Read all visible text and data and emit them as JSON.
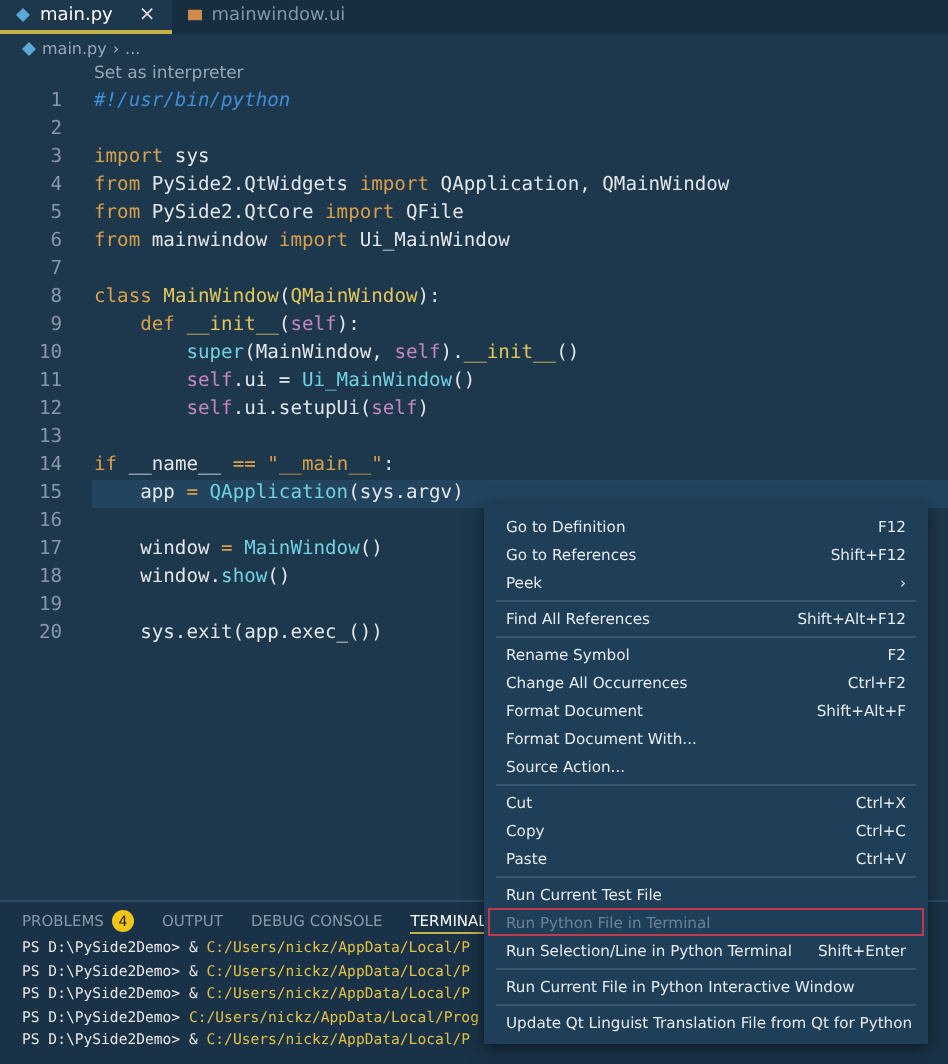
{
  "tabs": [
    {
      "label": "main.py",
      "selected": true,
      "close": "×",
      "kind": "python"
    },
    {
      "label": "mainwindow.ui",
      "selected": false,
      "kind": "ui"
    }
  ],
  "breadcrumb": {
    "file": "main.py",
    "separator": "›",
    "more": "..."
  },
  "codelens": "Set as interpreter",
  "editor": {
    "lines": [
      {
        "number": "1",
        "current": false,
        "tokens": [
          {
            "text": "#!/usr/bin/python",
            "kind": "comment"
          }
        ]
      },
      {
        "number": "2",
        "current": false
      },
      {
        "number": "3",
        "current": false,
        "tokens": [
          {
            "text": "import",
            "kind": "keyword"
          },
          {
            "text": " sys",
            "kind": "plain"
          }
        ]
      },
      {
        "number": "4",
        "current": false,
        "tokens": [
          {
            "text": "from",
            "kind": "keyword"
          },
          {
            "text": " PySide2.QtWidgets ",
            "kind": "plain"
          },
          {
            "text": "import",
            "kind": "keyword"
          },
          {
            "text": " QApplication, QMainWindow",
            "kind": "plain"
          }
        ]
      },
      {
        "number": "5",
        "current": false,
        "tokens": [
          {
            "text": "from",
            "kind": "keyword"
          },
          {
            "text": " PySide2.QtCore ",
            "kind": "plain"
          },
          {
            "text": "import",
            "kind": "keyword"
          },
          {
            "text": " QFile",
            "kind": "plain"
          }
        ]
      },
      {
        "number": "6",
        "current": false,
        "tokens": [
          {
            "text": "from",
            "kind": "keyword"
          },
          {
            "text": " mainwindow ",
            "kind": "plain"
          },
          {
            "text": "import",
            "kind": "keyword"
          },
          {
            "text": " Ui_MainWindow",
            "kind": "plain"
          }
        ]
      },
      {
        "number": "7",
        "current": false
      },
      {
        "number": "8",
        "current": false,
        "tokens": [
          {
            "text": "class",
            "kind": "keyword"
          },
          {
            "text": " MainWindow",
            "kind": "classname"
          },
          {
            "text": "(",
            "kind": "plain"
          },
          {
            "text": "QMainWindow",
            "kind": "classname"
          },
          {
            "text": "):",
            "kind": "plain"
          }
        ]
      },
      {
        "number": "9",
        "current": false,
        "tokens": [
          {
            "text": "    def",
            "kind": "keyword"
          },
          {
            "text": " __init__",
            "kind": "func"
          },
          {
            "text": "(",
            "kind": "plain"
          },
          {
            "text": "self",
            "kind": "self"
          },
          {
            "text": "):",
            "kind": "plain"
          }
        ]
      },
      {
        "number": "10",
        "current": false,
        "tokens": [
          {
            "text": "        super",
            "kind": "builtin"
          },
          {
            "text": "(MainWindow, ",
            "kind": "plain"
          },
          {
            "text": "self",
            "kind": "self"
          },
          {
            "text": ").",
            "kind": "plain"
          },
          {
            "text": "__init__",
            "kind": "func"
          },
          {
            "text": "()",
            "kind": "plain"
          }
        ]
      },
      {
        "number": "11",
        "current": false,
        "tokens": [
          {
            "text": "        self",
            "kind": "self"
          },
          {
            "text": ".ui = ",
            "kind": "plain"
          },
          {
            "text": "Ui_MainWindow",
            "kind": "builtin"
          },
          {
            "text": "()",
            "kind": "plain"
          }
        ]
      },
      {
        "number": "12",
        "current": false,
        "tokens": [
          {
            "text": "        self",
            "kind": "self"
          },
          {
            "text": ".ui.setupUi(",
            "kind": "plain"
          },
          {
            "text": "self",
            "kind": "self"
          },
          {
            "text": ")",
            "kind": "plain"
          }
        ]
      },
      {
        "number": "13",
        "current": false
      },
      {
        "number": "14",
        "current": false,
        "tokens": [
          {
            "text": "if",
            "kind": "keyword"
          },
          {
            "text": " __name__ ",
            "kind": "plain"
          },
          {
            "text": "==",
            "kind": "keyword"
          },
          {
            "text": " \"__main__\"",
            "kind": "string"
          },
          {
            "text": ":",
            "kind": "plain"
          }
        ]
      },
      {
        "number": "15",
        "current": true,
        "tokens": [
          {
            "text": "    app ",
            "kind": "plain"
          },
          {
            "text": "=",
            "kind": "keyword"
          },
          {
            "text": " QApplication",
            "kind": "builtin"
          },
          {
            "text": "(sys.argv)",
            "kind": "plain"
          }
        ]
      },
      {
        "number": "16",
        "current": false
      },
      {
        "number": "17",
        "current": false,
        "tokens": [
          {
            "text": "    window ",
            "kind": "plain"
          },
          {
            "text": "=",
            "kind": "keyword"
          },
          {
            "text": " MainWindow",
            "kind": "builtin"
          },
          {
            "text": "()",
            "kind": "plain"
          }
        ]
      },
      {
        "number": "18",
        "current": false,
        "tokens": [
          {
            "text": "    window.",
            "kind": "plain"
          },
          {
            "text": "show",
            "kind": "builtin"
          },
          {
            "text": "()",
            "kind": "plain"
          }
        ]
      },
      {
        "number": "19",
        "current": false
      },
      {
        "number": "20",
        "current": false,
        "tokens": [
          {
            "text": "    sys.exit(app.exec_())",
            "kind": "plain"
          }
        ]
      }
    ]
  },
  "panel": {
    "tabs": [
      {
        "label": "PROBLEMS",
        "selected": false,
        "badge": "4"
      },
      {
        "label": "OUTPUT",
        "selected": false
      },
      {
        "label": "DEBUG CONSOLE",
        "selected": false
      },
      {
        "label": "TERMINAL",
        "selected": true
      }
    ],
    "terminal": [
      [
        {
          "text": "PS D:\\PySide2Demo> & ",
          "kind": "prompt"
        },
        {
          "text": "C:/Users/nickz/AppData/Local/P",
          "kind": "path"
        }
      ],
      [
        {
          "text": "PS D:\\PySide2Demo> & ",
          "kind": "prompt"
        },
        {
          "text": "C:/Users/nickz/AppData/Local/P",
          "kind": "path"
        }
      ],
      [
        {
          "text": "PS D:\\PySide2Demo> & ",
          "kind": "prompt"
        },
        {
          "text": "C:/Users/nickz/AppData/Local/P",
          "kind": "path"
        }
      ],
      [
        {
          "text": "PS D:\\PySide2Demo> ",
          "kind": "prompt"
        },
        {
          "text": "C:/Users/nickz/AppData/Local/Prog",
          "kind": "path"
        }
      ],
      [
        {
          "text": "PS D:\\PySide2Demo> & ",
          "kind": "prompt"
        },
        {
          "text": "C:/Users/nickz/AppData/Local/P",
          "kind": "path"
        }
      ]
    ]
  },
  "context_menu": [
    {
      "kind": "item",
      "label": "Go to Definition",
      "shortcut": "F12",
      "disabled": false,
      "highlighted": false
    },
    {
      "kind": "item",
      "label": "Go to References",
      "shortcut": "Shift+F12",
      "disabled": false,
      "highlighted": false
    },
    {
      "kind": "item",
      "label": "Peek",
      "submenu": "›",
      "disabled": false,
      "highlighted": false
    },
    {
      "kind": "separator"
    },
    {
      "kind": "item",
      "label": "Find All References",
      "shortcut": "Shift+Alt+F12",
      "disabled": false,
      "highlighted": false
    },
    {
      "kind": "separator"
    },
    {
      "kind": "item",
      "label": "Rename Symbol",
      "shortcut": "F2",
      "disabled": false,
      "highlighted": false
    },
    {
      "kind": "item",
      "label": "Change All Occurrences",
      "shortcut": "Ctrl+F2",
      "disabled": false,
      "highlighted": false
    },
    {
      "kind": "item",
      "label": "Format Document",
      "shortcut": "Shift+Alt+F",
      "disabled": false,
      "highlighted": false
    },
    {
      "kind": "item",
      "label": "Format Document With...",
      "disabled": false,
      "highlighted": false
    },
    {
      "kind": "item",
      "label": "Source Action...",
      "disabled": false,
      "highlighted": false
    },
    {
      "kind": "separator"
    },
    {
      "kind": "item",
      "label": "Cut",
      "shortcut": "Ctrl+X",
      "disabled": false,
      "highlighted": false
    },
    {
      "kind": "item",
      "label": "Copy",
      "shortcut": "Ctrl+C",
      "disabled": false,
      "highlighted": false
    },
    {
      "kind": "item",
      "label": "Paste",
      "shortcut": "Ctrl+V",
      "disabled": false,
      "highlighted": false
    },
    {
      "kind": "separator"
    },
    {
      "kind": "item",
      "label": "Run Current Test File",
      "disabled": false,
      "highlighted": false
    },
    {
      "kind": "item",
      "label": "Run Python File in Terminal",
      "disabled": true,
      "highlighted": true
    },
    {
      "kind": "item",
      "label": "Run Selection/Line in Python Terminal",
      "shortcut": "Shift+Enter",
      "disabled": false,
      "highlighted": false
    },
    {
      "kind": "separator"
    },
    {
      "kind": "item",
      "label": "Run Current File in Python Interactive Window",
      "disabled": false,
      "highlighted": false
    },
    {
      "kind": "separator"
    },
    {
      "kind": "item",
      "label": "Update Qt Linguist Translation File from Qt for Python",
      "disabled": false,
      "highlighted": false
    }
  ]
}
